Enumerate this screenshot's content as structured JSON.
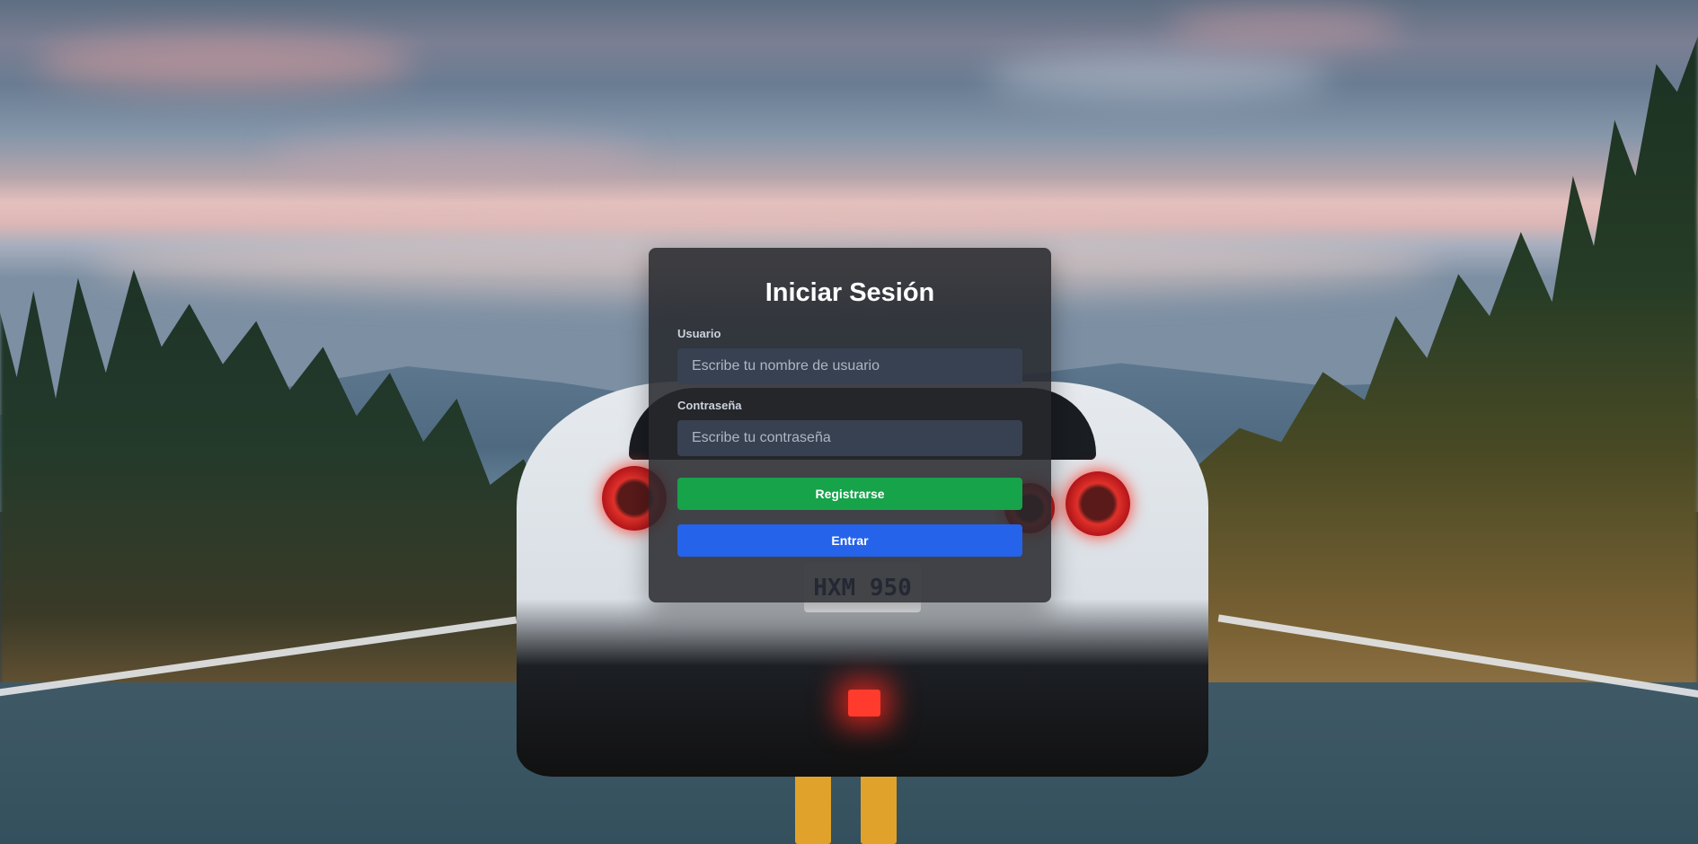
{
  "login": {
    "title": "Iniciar Sesión",
    "username_label": "Usuario",
    "username_placeholder": "Escribe tu nombre de usuario",
    "username_value": "",
    "password_label": "Contraseña",
    "password_placeholder": "Escribe tu contraseña",
    "password_value": "",
    "register_button": "Registrarse",
    "login_button": "Entrar"
  },
  "background": {
    "plate_text": "HXM 950"
  },
  "colors": {
    "card_bg": "#26282c",
    "input_bg": "#374151",
    "register_green": "#16a34a",
    "login_blue": "#2563eb"
  }
}
